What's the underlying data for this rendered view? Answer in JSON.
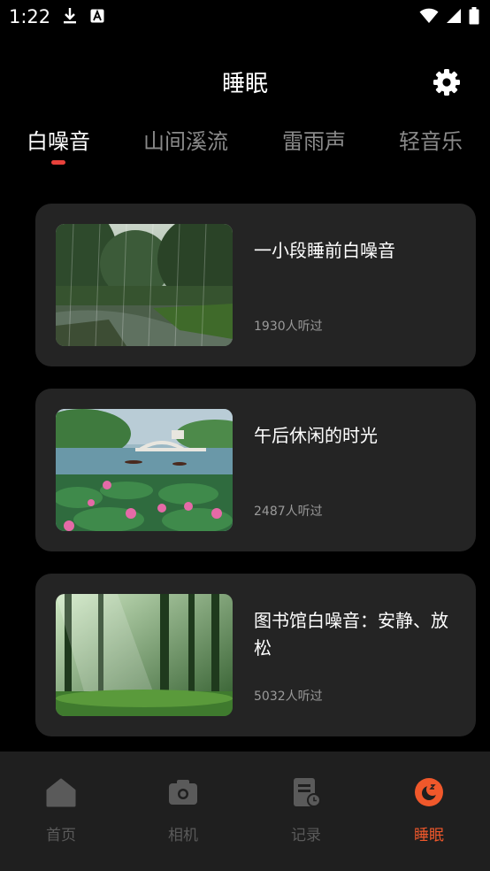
{
  "status_bar": {
    "time": "1:22",
    "left_icons": [
      "download-icon",
      "a-badge-icon"
    ],
    "right_icons": [
      "wifi-icon",
      "signal-icon",
      "battery-icon"
    ]
  },
  "header": {
    "title": "睡眠",
    "settings_icon": "gear-icon"
  },
  "tabs": [
    {
      "label": "白噪音",
      "active": true
    },
    {
      "label": "山间溪流",
      "active": false
    },
    {
      "label": "雷雨声",
      "active": false
    },
    {
      "label": "轻音乐",
      "active": false
    }
  ],
  "cards": [
    {
      "title": "一小段睡前白噪音",
      "count": "1930人听过",
      "image": "rainy-forest-pond-image"
    },
    {
      "title": "午后休闲的时光",
      "count": "2487人听过",
      "image": "lotus-lake-bridge-image"
    },
    {
      "title": "图书馆白噪音：安静、放松",
      "count": "5032人听过",
      "image": "sunlit-forest-image"
    }
  ],
  "bottom_nav": [
    {
      "label": "首页",
      "icon": "home-icon",
      "active": false
    },
    {
      "label": "相机",
      "icon": "camera-icon",
      "active": false
    },
    {
      "label": "记录",
      "icon": "record-icon",
      "active": false
    },
    {
      "label": "睡眠",
      "icon": "moon-icon",
      "active": true
    }
  ],
  "colors": {
    "background": "#000000",
    "card": "#242424",
    "tab_indicator": "#e8413b",
    "nav_active": "#f0582b",
    "nav_inactive": "#5a5a5a"
  }
}
